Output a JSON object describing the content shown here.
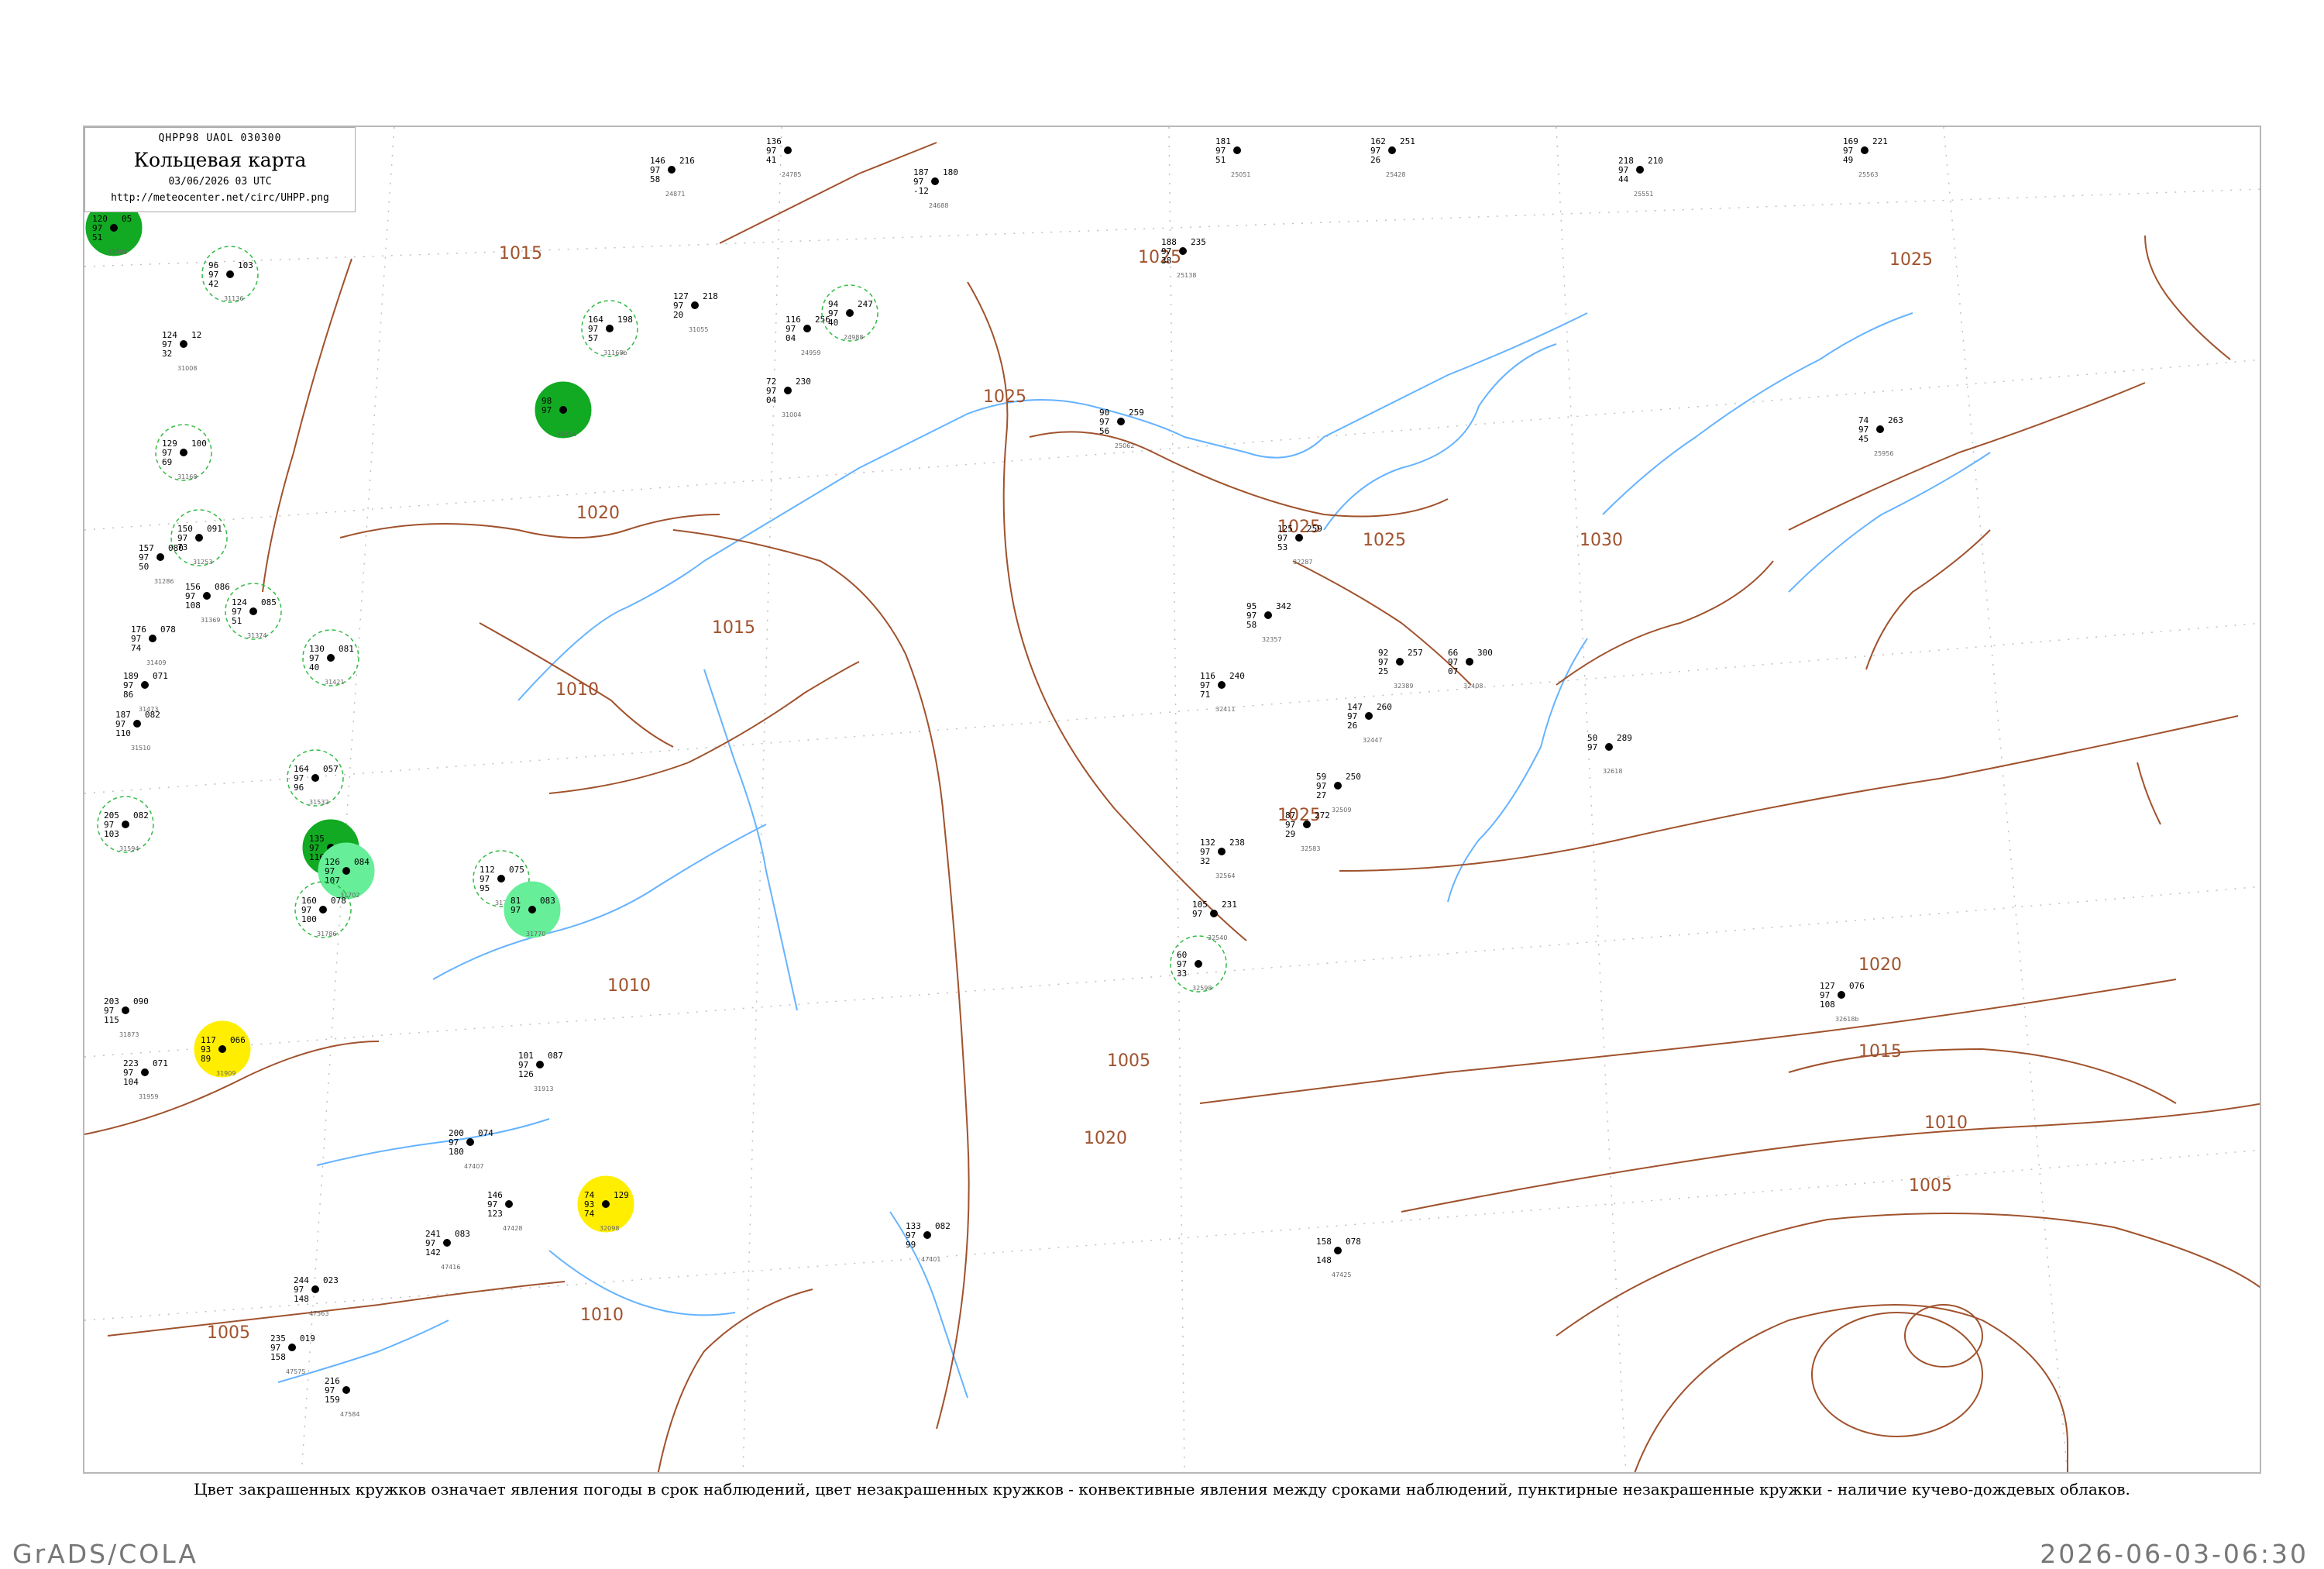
{
  "header": {
    "code": "QHPP98  UAOL  030300",
    "title": "Кольцевая карта",
    "date": "03/06/2026 03 UTC",
    "url": "http://meteocenter.net/circ/UHPP.png"
  },
  "caption": "Цвет закрашенных кружков означает явления погоды в срок наблюдений, цвет незакрашенных кружков - конвективные явления между сроками наблюдений, пунктирные незакрашенные кружки - наличие кучево-дождевых облаков.",
  "footer": {
    "left": "GrADS/COLA",
    "right": "2026-06-03-06:30"
  },
  "isobar_labels": [
    "1015",
    "1025",
    "1025",
    "1025",
    "1020",
    "1015",
    "1010",
    "1025",
    "1030",
    "1025",
    "1025",
    "1020",
    "1015",
    "1010",
    "1005",
    "1005",
    "1005",
    "1020",
    "1010",
    "1010"
  ],
  "colors": {
    "isobar": "#a0522d",
    "river": "#66b3ff",
    "fill_green": "#11aa22",
    "fill_light_green": "#66ee99",
    "fill_yellow": "#ffee00",
    "dashed_ring": "#33bb44"
  },
  "stations": [
    {
      "id": "31005",
      "t": "120",
      "p": "97",
      "v": "51",
      "n": "05",
      "color": "green"
    },
    {
      "id": "31008",
      "t": "124",
      "p": "97",
      "v": "32",
      "n": "12",
      "color": "none"
    },
    {
      "id": "31136",
      "t": "96",
      "p": "97",
      "v": "42",
      "n": "103",
      "color": "dashed"
    },
    {
      "id": "31168",
      "t": "129",
      "p": "97",
      "v": "69",
      "n": "100",
      "color": "dashed"
    },
    {
      "id": "31253",
      "t": "150",
      "p": "97",
      "v": "73",
      "n": "091",
      "color": "dashed"
    },
    {
      "id": "31286",
      "t": "157",
      "p": "97",
      "v": "50",
      "n": "080",
      "color": "none"
    },
    {
      "id": "31369",
      "t": "156",
      "p": "97",
      "v": "108",
      "n": "086",
      "color": "none"
    },
    {
      "id": "31374",
      "t": "124",
      "p": "97",
      "v": "51",
      "n": "085",
      "color": "dashed"
    },
    {
      "id": "31409",
      "t": "176",
      "p": "97",
      "v": "74",
      "n": "078",
      "color": "none"
    },
    {
      "id": "31421",
      "t": "130",
      "p": "97",
      "v": "40",
      "n": "081",
      "color": "dashed"
    },
    {
      "id": "31473",
      "t": "189",
      "p": "97",
      "v": "86",
      "n": "071",
      "color": "none"
    },
    {
      "id": "31510",
      "t": "187",
      "p": "97",
      "v": "110",
      "n": "082",
      "color": "none"
    },
    {
      "id": "31532",
      "t": "164",
      "p": "97",
      "v": "96",
      "n": "057",
      "color": "dashed"
    },
    {
      "id": "31594",
      "t": "205",
      "p": "97",
      "v": "103",
      "n": "082",
      "color": "dashed"
    },
    {
      "id": "31677",
      "t": "135",
      "p": "97",
      "v": "116",
      "n": "",
      "color": "green"
    },
    {
      "id": "31702",
      "t": "126",
      "p": "97",
      "v": "107",
      "n": "084",
      "color": "light-green"
    },
    {
      "id": "31725",
      "t": "112",
      "p": "97",
      "v": "95",
      "n": "075",
      "color": "dashed"
    },
    {
      "id": "31770",
      "t": "81",
      "p": "97",
      "v": "",
      "n": "083",
      "color": "light-green"
    },
    {
      "id": "31786",
      "t": "160",
      "p": "97",
      "v": "100",
      "n": "078",
      "color": "dashed"
    },
    {
      "id": "31873",
      "t": "203",
      "p": "97",
      "v": "115",
      "n": "090",
      "color": "none"
    },
    {
      "id": "31909",
      "t": "117",
      "p": "93",
      "v": "89",
      "n": "066",
      "color": "yellow"
    },
    {
      "id": "31959",
      "t": "223",
      "p": "97",
      "v": "104",
      "n": "071",
      "color": "none"
    },
    {
      "id": "31913",
      "t": "101",
      "p": "97",
      "v": "126",
      "n": "087",
      "color": "none"
    },
    {
      "id": "32098",
      "t": "74",
      "p": "93",
      "v": "74",
      "n": "129",
      "color": "yellow"
    },
    {
      "id": "31166",
      "t": "98",
      "p": "97",
      "v": "",
      "n": "",
      "color": "green"
    },
    {
      "id": "31168b",
      "t": "164",
      "p": "97",
      "v": "57",
      "n": "198",
      "color": "dashed"
    },
    {
      "id": "31055",
      "t": "127",
      "p": "97",
      "v": "20",
      "n": "218",
      "color": "none"
    },
    {
      "id": "24959",
      "t": "116",
      "p": "97",
      "v": "04",
      "n": "256",
      "color": "none"
    },
    {
      "id": "24988",
      "t": "94",
      "p": "97",
      "v": "40",
      "n": "247",
      "color": "dashed"
    },
    {
      "id": "31004",
      "t": "72",
      "p": "97",
      "v": "04",
      "n": "230",
      "color": "none"
    },
    {
      "id": "24785",
      "t": "136",
      "p": "97",
      "v": "41",
      "n": "",
      "color": "none"
    },
    {
      "id": "24688",
      "t": "187",
      "p": "97",
      "v": "-12",
      "n": "180",
      "color": "none"
    },
    {
      "id": "24871",
      "t": "146",
      "p": "97",
      "v": "58",
      "n": "216",
      "color": "none"
    },
    {
      "id": "25062",
      "t": "90",
      "p": "97",
      "v": "56",
      "n": "259",
      "color": "none"
    },
    {
      "id": "25138",
      "t": "188",
      "p": "97",
      "v": "38",
      "n": "235",
      "color": "none"
    },
    {
      "id": "25051",
      "t": "181",
      "p": "97",
      "v": "51",
      "n": "",
      "color": "none"
    },
    {
      "id": "25428",
      "t": "162",
      "p": "97",
      "v": "26",
      "n": "251",
      "color": "none"
    },
    {
      "id": "25551",
      "t": "218",
      "p": "97",
      "v": "44",
      "n": "210",
      "color": "none"
    },
    {
      "id": "25563",
      "t": "169",
      "p": "97",
      "v": "49",
      "n": "221",
      "color": "none"
    },
    {
      "id": "25956",
      "t": "74",
      "p": "97",
      "v": "45",
      "n": "263",
      "color": "none"
    },
    {
      "id": "32287",
      "t": "125",
      "p": "97",
      "v": "53",
      "n": "259",
      "color": "none"
    },
    {
      "id": "32357",
      "t": "95",
      "p": "97",
      "v": "58",
      "n": "342",
      "color": "none"
    },
    {
      "id": "32389",
      "t": "92",
      "p": "97",
      "v": "25",
      "n": "257",
      "color": "none"
    },
    {
      "id": "32408",
      "t": "66",
      "p": "97",
      "v": "07",
      "n": "300",
      "color": "none"
    },
    {
      "id": "32411",
      "t": "116",
      "p": "97",
      "v": "71",
      "n": "240",
      "color": "none"
    },
    {
      "id": "32447",
      "t": "147",
      "p": "97",
      "v": "26",
      "n": "260",
      "color": "none"
    },
    {
      "id": "32509",
      "t": "59",
      "p": "97",
      "v": "27",
      "n": "250",
      "color": "none"
    },
    {
      "id": "32618",
      "t": "50",
      "p": "97",
      "v": "",
      "n": "289",
      "color": "none"
    },
    {
      "id": "32583",
      "t": "87",
      "p": "97",
      "v": "29",
      "n": "272",
      "color": "none"
    },
    {
      "id": "32564",
      "t": "132",
      "p": "97",
      "v": "32",
      "n": "238",
      "color": "none"
    },
    {
      "id": "32540",
      "t": "105",
      "p": "97",
      "v": "",
      "n": "231",
      "color": "none"
    },
    {
      "id": "32598",
      "t": "60",
      "p": "97",
      "v": "33",
      "n": "",
      "color": "dashed"
    },
    {
      "id": "32618b",
      "t": "127",
      "p": "97",
      "v": "108",
      "n": "076",
      "color": "none"
    },
    {
      "id": "47401",
      "t": "133",
      "p": "97",
      "v": "99",
      "n": "082",
      "color": "none"
    },
    {
      "id": "47425",
      "t": "158",
      "p": "",
      "v": "148",
      "n": "078",
      "color": "none"
    },
    {
      "id": "47407",
      "t": "200",
      "p": "97",
      "v": "180",
      "n": "074",
      "color": "none"
    },
    {
      "id": "47428",
      "t": "146",
      "p": "97",
      "v": "123",
      "n": "",
      "color": "none"
    },
    {
      "id": "47416",
      "t": "241",
      "p": "97",
      "v": "142",
      "n": "083",
      "color": "none"
    },
    {
      "id": "47563",
      "t": "244",
      "p": "97",
      "v": "148",
      "n": "023",
      "color": "none"
    },
    {
      "id": "47575",
      "t": "235",
      "p": "97",
      "v": "158",
      "n": "019",
      "color": "none"
    },
    {
      "id": "47584",
      "t": "216",
      "p": "97",
      "v": "159",
      "n": "",
      "color": "none"
    }
  ]
}
